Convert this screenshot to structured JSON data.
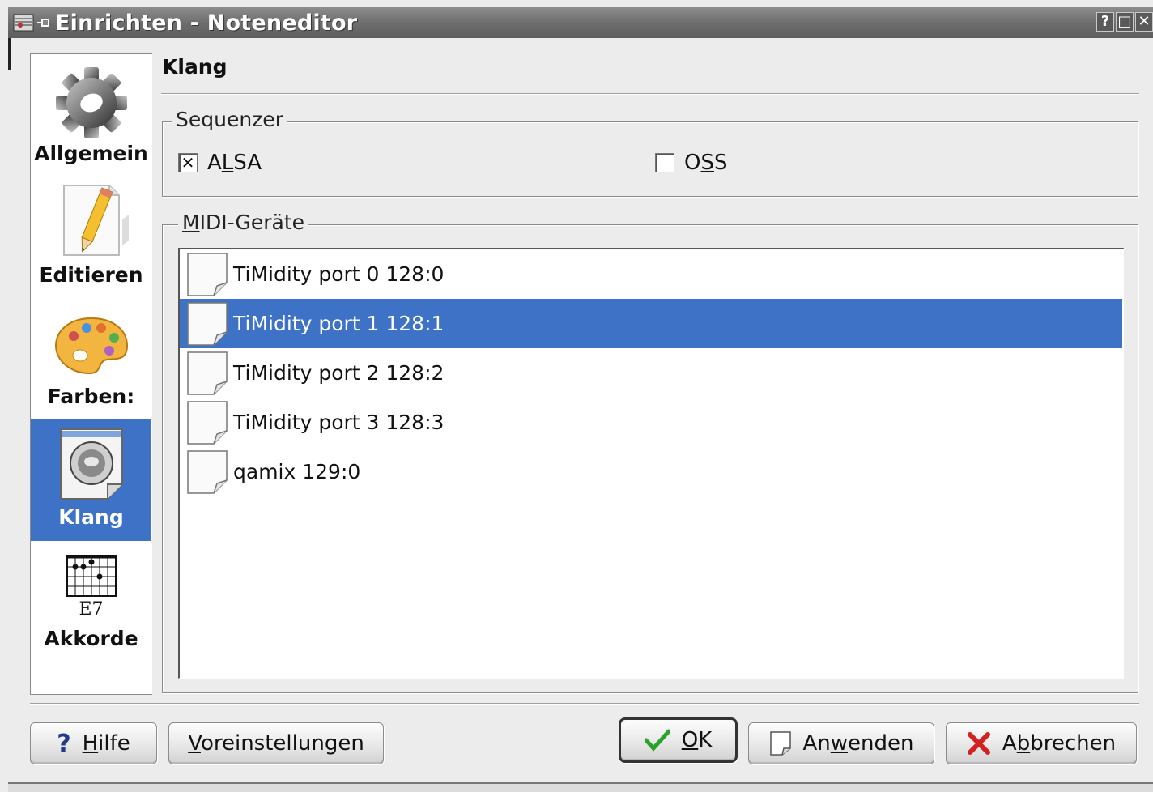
{
  "window": {
    "title": "Einrichten - Noteneditor",
    "buttons": {
      "help": "?",
      "maximize": "□",
      "close": "✕"
    }
  },
  "sidebar": {
    "items": [
      {
        "label": "Allgemein",
        "icon": "gear-icon"
      },
      {
        "label": "Editieren",
        "icon": "pencil-document-icon"
      },
      {
        "label": "Farben:",
        "icon": "palette-icon"
      },
      {
        "label": "Klang",
        "icon": "speaker-icon",
        "active": true
      },
      {
        "label": "Akkorde",
        "icon": "chord-diagram-icon",
        "icon_caption": "E7"
      }
    ]
  },
  "page": {
    "header": "Klang",
    "sequencer": {
      "title": "Sequenzer",
      "alsa": {
        "label": "ALSA",
        "checked": true
      },
      "oss": {
        "label": "OSS",
        "checked": false
      }
    },
    "midi": {
      "title": "MIDI-Geräte",
      "devices": [
        "TiMidity port 0 128:0",
        "TiMidity port 1 128:1",
        "TiMidity port 2 128:2",
        "TiMidity port 3 128:3",
        "qamix 129:0"
      ],
      "selected_index": 1
    }
  },
  "buttons": {
    "help": "Hilfe",
    "defaults": "Voreinstellungen",
    "ok": "OK",
    "apply": "Anwenden",
    "cancel": "Abbrechen"
  },
  "colors": {
    "selection": "#3e72c6",
    "ok_check": "#2aa12a",
    "cancel_x": "#d42020"
  }
}
